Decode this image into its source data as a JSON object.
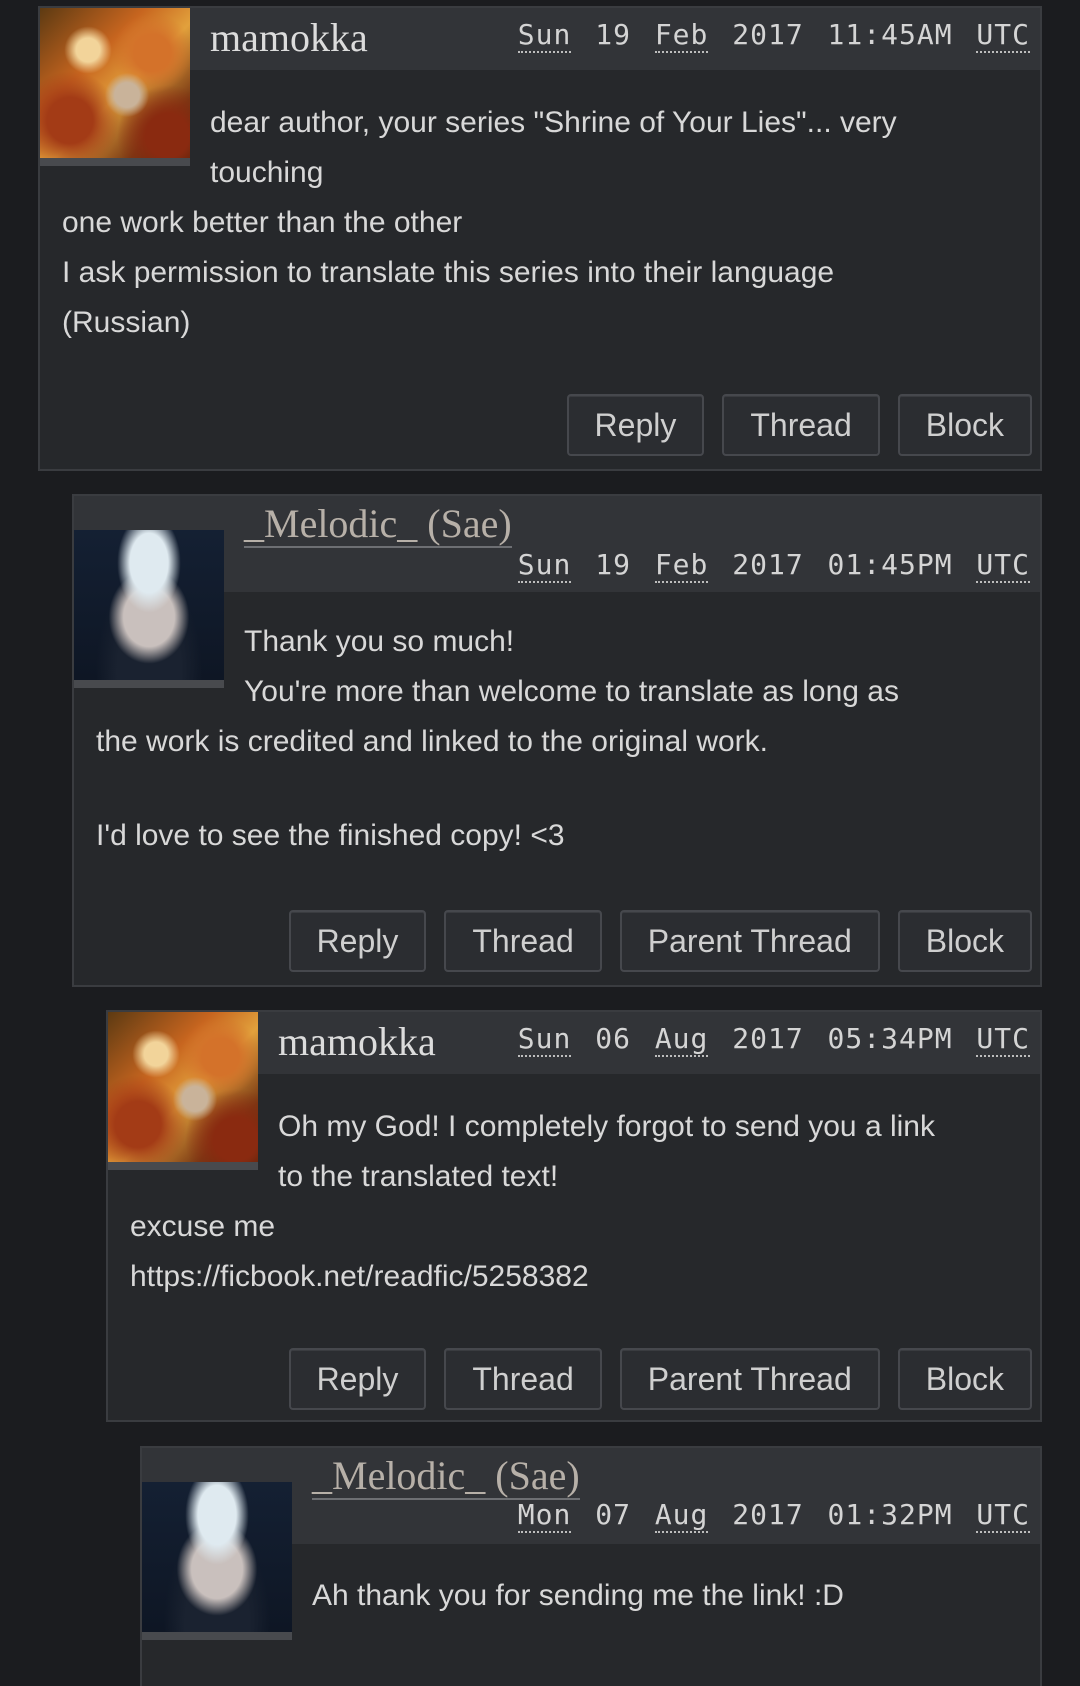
{
  "comments": [
    {
      "username": "mamokka",
      "date": {
        "day": "Sun",
        "dd": "19",
        "month": "Feb",
        "year": "2017",
        "time": "11:45AM",
        "tz": "UTC"
      },
      "lines_beside": [
        "dear author, your series \"Shrine of Your Lies\"... very",
        "touching"
      ],
      "lines_below": [
        "one work better than the other",
        "I ask permission to translate this series into their language",
        "(Russian)"
      ],
      "actions": [
        "Reply",
        "Thread",
        "Block"
      ]
    },
    {
      "username": "_Melodic_ (Sae)",
      "date": {
        "day": "Sun",
        "dd": "19",
        "month": "Feb",
        "year": "2017",
        "time": "01:45PM",
        "tz": "UTC"
      },
      "lines_beside": [
        "Thank you so much!",
        "You're more than welcome to translate as long as"
      ],
      "lines_below": [
        "the work is credited and linked to the original work.",
        "",
        "I'd love to see the finished copy! <3"
      ],
      "actions": [
        "Reply",
        "Thread",
        "Parent Thread",
        "Block"
      ]
    },
    {
      "username": "mamokka",
      "date": {
        "day": "Sun",
        "dd": "06",
        "month": "Aug",
        "year": "2017",
        "time": "05:34PM",
        "tz": "UTC"
      },
      "lines_beside": [
        "Oh my God! I completely forgot to send you a link",
        "to the translated text!"
      ],
      "lines_below": [
        "excuse me",
        "https://ficbook.net/readfic/5258382"
      ],
      "actions": [
        "Reply",
        "Thread",
        "Parent Thread",
        "Block"
      ]
    },
    {
      "username": "_Melodic_ (Sae)",
      "date": {
        "day": "Mon",
        "dd": "07",
        "month": "Aug",
        "year": "2017",
        "time": "01:32PM",
        "tz": "UTC"
      },
      "lines_beside": [
        "Ah thank you for sending me the link! :D"
      ],
      "lines_below": [],
      "actions": []
    }
  ]
}
